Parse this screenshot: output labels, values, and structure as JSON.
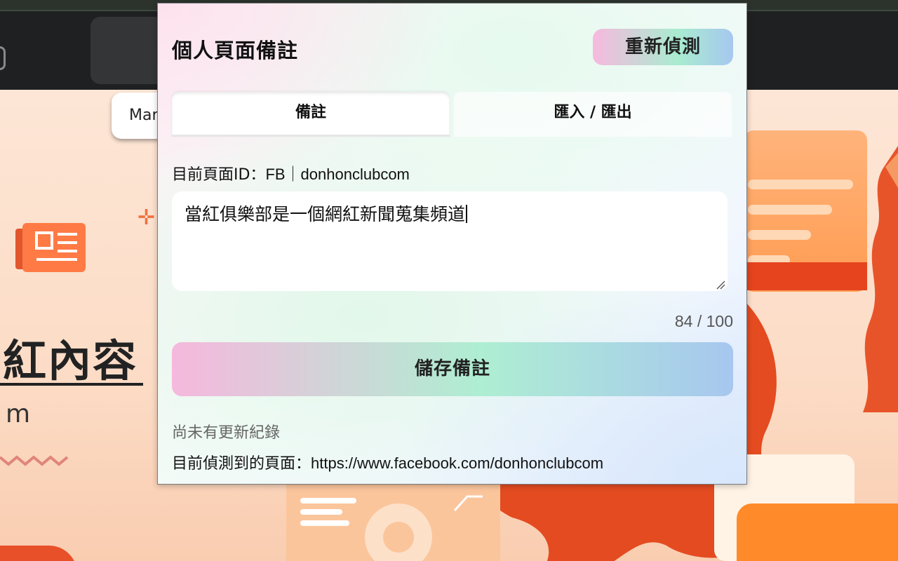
{
  "background": {
    "pill_text": "Mar",
    "title_fragment": "紅內容",
    "subtitle_fragment": "m"
  },
  "popup": {
    "title": "個人頁面備註",
    "redetect_label": "重新偵測",
    "tabs": [
      {
        "label": "備註",
        "active": true
      },
      {
        "label": "匯入 / 匯出",
        "active": false
      }
    ],
    "page_id_label": "目前頁面ID：",
    "page_id_value": "FB｜donhonclubcom",
    "note_text": "當紅俱樂部是一個網紅新聞蒐集頻道",
    "counter": "84 / 100",
    "save_label": "儲存備註",
    "status_text": "尚未有更新紀錄",
    "detected_label": "目前偵測到的頁面：",
    "detected_url": "https://www.facebook.com/donhonclubcom",
    "colors": {
      "accent_pink": "#f6b8dd",
      "accent_mint": "#aeeed2",
      "accent_blue": "#a7c7ef"
    }
  }
}
